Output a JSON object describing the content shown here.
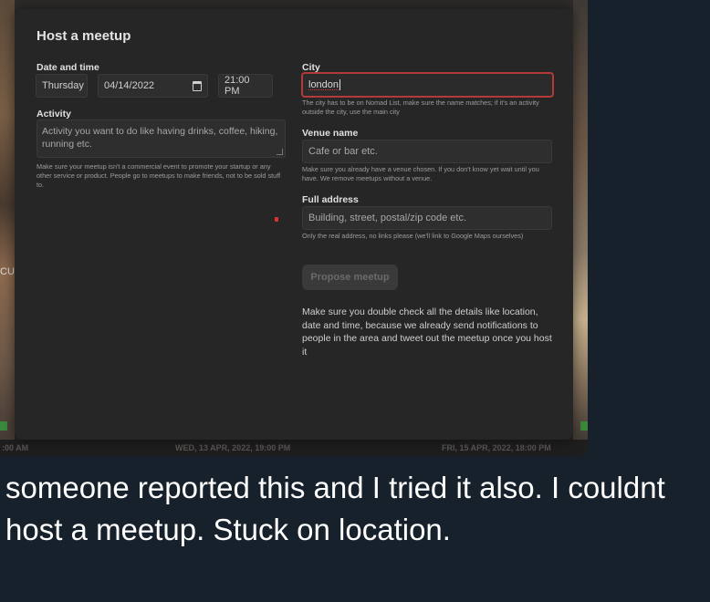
{
  "modal": {
    "title": "Host a meetup",
    "date_time": {
      "label": "Date and time",
      "weekday": "Thursday",
      "date": "04/14/2022",
      "time": "21:00 PM"
    },
    "activity": {
      "label": "Activity",
      "placeholder": "Activity you want to do like having drinks, coffee, hiking, running etc.",
      "help": "Make sure your meetup isn't a commercial event to promote your startup or any other service or product. People go to meetups to make friends, not to be sold stuff to."
    },
    "city": {
      "label": "City",
      "value": "london",
      "help": "The city has to be on Nomad List, make sure the name matches; if it's an activity outside the city, use the main city"
    },
    "venue": {
      "label": "Venue name",
      "placeholder": "Cafe or bar etc.",
      "help": "Make sure you already have a venue chosen. If you don't know yet wait until you have. We remove meetups without a venue."
    },
    "address": {
      "label": "Full address",
      "placeholder": "Building, street, postal/zip code etc.",
      "help": "Only the real address, no links please (we'll link to Google Maps ourselves)"
    },
    "propose_button": "Propose meetup",
    "note": "Make sure you double check all the details like location, date and time, because we already send notifications to people in the area and tweet out the meetup once you host it"
  },
  "background": {
    "left_fragment": "CU",
    "dates": [
      ":00 AM",
      "WED, 13 APR, 2022, 19:00 PM",
      "FRI, 15 APR, 2022, 18:00 PM"
    ]
  },
  "caption": "someone reported this and I tried it also. I couldnt host a meetup. Stuck on location.",
  "colors": {
    "error_border": "#b23a3a",
    "modal_bg": "#262626",
    "page_bg": "#17212b"
  }
}
